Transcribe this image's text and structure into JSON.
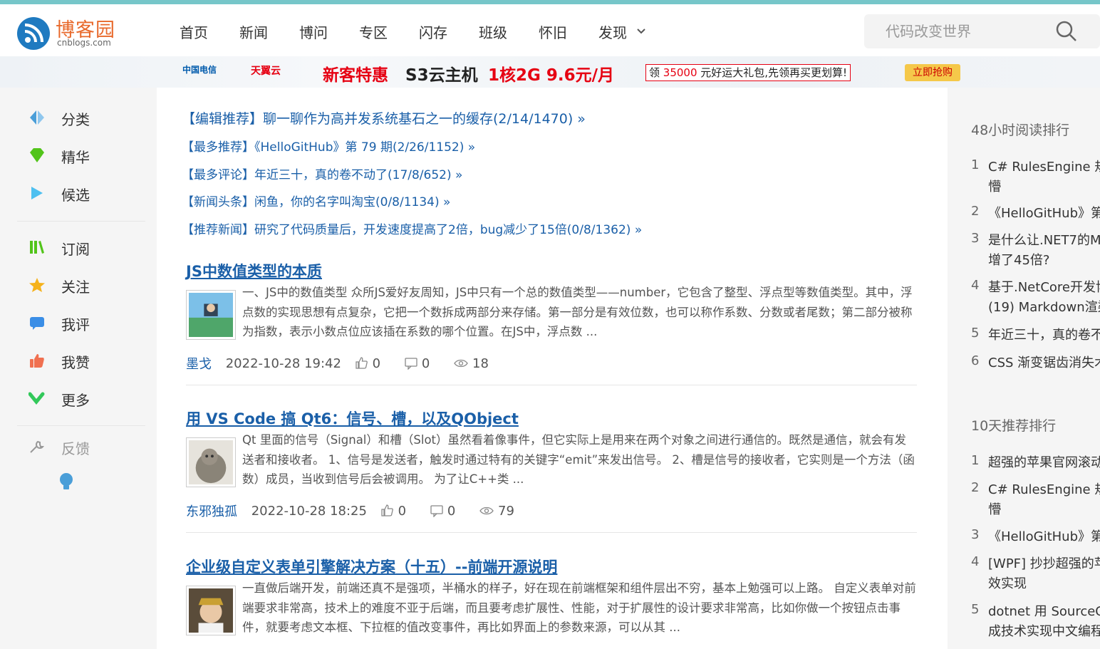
{
  "header": {
    "logo_text": "博客园",
    "logo_domain": "cnblogs.com",
    "nav": [
      {
        "label": "首页"
      },
      {
        "label": "新闻"
      },
      {
        "label": "博问"
      },
      {
        "label": "专区"
      },
      {
        "label": "闪存"
      },
      {
        "label": "班级"
      },
      {
        "label": "怀旧"
      },
      {
        "label": "发现"
      }
    ],
    "search_placeholder": "代码改变世界"
  },
  "banner": {
    "brand1": "中国电信",
    "brand2": "天翼云",
    "promo_a": "新客特惠",
    "promo_b": "S3云主机",
    "promo_c": "1核2G  9.6元/月",
    "gift_pre": "领 ",
    "gift_num": "35000",
    "gift_post": " 元好运大礼包,先领再买更划算!",
    "cta": "立即抢购"
  },
  "sidebar": {
    "items": [
      {
        "label": "分类",
        "icon": "category-icon",
        "color": "#4a9ed8"
      },
      {
        "label": "精华",
        "icon": "gem-icon",
        "color": "#52c41a"
      },
      {
        "label": "候选",
        "icon": "play-icon",
        "color": "#4ec0f0"
      },
      {
        "label": "订阅",
        "icon": "books-icon",
        "color": "#52c41a"
      },
      {
        "label": "关注",
        "icon": "star-icon",
        "color": "#f5b21a"
      },
      {
        "label": "我评",
        "icon": "comment-icon",
        "color": "#3a8ee6"
      },
      {
        "label": "我赞",
        "icon": "thumb-icon",
        "color": "#f07050"
      },
      {
        "label": "更多",
        "icon": "chevron-down-icon",
        "color": "#32c85a"
      }
    ],
    "feedback": "反馈"
  },
  "recommends": [
    "【编辑推荐】聊一聊作为高并发系统基石之一的缓存(2/14/1470) »",
    "【最多推荐】《HelloGitHub》第 79 期(2/26/1152) »",
    "【最多评论】年近三十，真的卷不动了(17/8/652) »",
    "【新闻头条】闲鱼，你的名字叫淘宝(0/8/1134) »",
    "【推荐新闻】研究了代码质量后，开发速度提高了2倍，bug减少了15倍(0/8/1362) »"
  ],
  "posts": [
    {
      "title": "JS中数值类型的本质",
      "summary": "一、JS中的数值类型 众所JS爱好友周知，JS中只有一个总的数值类型——number，它包含了整型、浮点型等数值类型。其中，浮点数的实现思想有点复杂，它把一个数拆成两部分来存储。第一部分是有效位数，也可以称作系数、分数或者尾数；第二部分被称为指数，表示小数点位应该插在系数的哪个位置。在JS中，浮点数 ...",
      "author": "墨戈",
      "date": "2022-10-28 19:42",
      "likes": "0",
      "comments": "0",
      "views": "18"
    },
    {
      "title": "用 VS Code 搞 Qt6：信号、槽，以及QObject",
      "summary": "Qt 里面的信号（Signal）和槽（Slot）虽然看着像事件，但它实际上是用来在两个对象之间进行通信的。既然是通信，就会有发送者和接收者。 1、信号是发送者，触发时通过特有的关键字“emit”来发出信号。 2、槽是信号的接收者，它实则是一个方法（函数）成员，当收到信号后会被调用。 为了让C++类 ...",
      "author": "东邪独孤",
      "date": "2022-10-28 18:25",
      "likes": "0",
      "comments": "0",
      "views": "79"
    },
    {
      "title": "企业级自定义表单引擎解决方案（十五）--前端开源说明",
      "summary": "一直做后端开发，前端还真不是强项，半桶水的样子，好在现在前端框架和组件层出不穷，基本上勉强可以上路。 自定义表单对前端要求非常高，技术上的难度不亚于后端，而且要考虑扩展性、性能，对于扩展性的设计要求非常高，比如你做一个按钮点击事件，就要考虑文本框、下拉框的值改变事件，再比如界面上的参数来源，可以从其 ..."
    }
  ],
  "right": {
    "head48": "48小时阅读排行",
    "rank48": [
      {
        "n": "1",
        "l1": "C# RulesEngine 规",
        "l2": "懵"
      },
      {
        "n": "2",
        "l1": "《HelloGitHub》第",
        "l2": ""
      },
      {
        "n": "3",
        "l1": "是什么让.NET7的M",
        "l2": "增了45倍?"
      },
      {
        "n": "4",
        "l1": "基于.NetCore开发博",
        "l2": "(19) Markdown渲染"
      },
      {
        "n": "5",
        "l1": "年近三十，真的卷不",
        "l2": ""
      },
      {
        "n": "6",
        "l1": "CSS 渐变锯齿消失术",
        "l2": ""
      }
    ],
    "head10": "10天推荐排行",
    "rank10": [
      {
        "n": "1",
        "l1": "超强的苹果官网滚动",
        "l2": ""
      },
      {
        "n": "2",
        "l1": "C# RulesEngine 规",
        "l2": "懵"
      },
      {
        "n": "3",
        "l1": "《HelloGitHub》第",
        "l2": ""
      },
      {
        "n": "4",
        "l1": "[WPF] 抄抄超强的苹",
        "l2": "效实现"
      },
      {
        "n": "5",
        "l1": "dotnet 用 SourceG",
        "l2": "成技术实现中文编程"
      }
    ]
  }
}
